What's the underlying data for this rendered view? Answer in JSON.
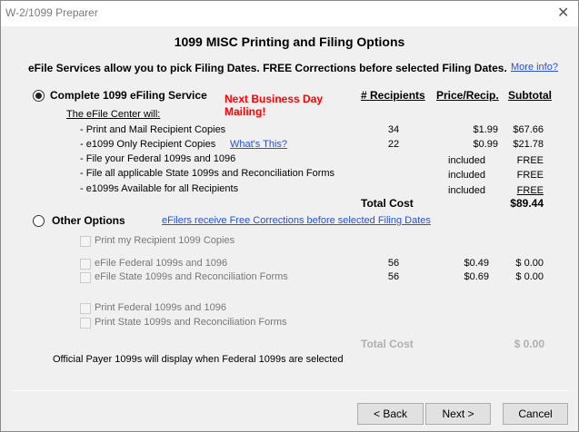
{
  "window": {
    "title": "W-2/1099 Preparer"
  },
  "heading": "1099 MISC Printing and Filing Options",
  "intro": "eFile Services allow you to pick Filing Dates. FREE Corrections before selected Filing Dates.",
  "more_info": "More info?",
  "complete": {
    "label": "Complete 1099 eFiling Service",
    "selected": true,
    "promo_line1": "Next Business Day",
    "promo_line2": "Mailing!",
    "headers": {
      "recipients": "# Recipients",
      "price": "Price/Recip.",
      "subtotal": "Subtotal"
    },
    "center_label": "The eFile Center will:",
    "whats_this": "What's This?",
    "rows": [
      {
        "label": "-  Print and Mail Recipient Copies",
        "recipients": "34",
        "price": "$1.99",
        "subtotal": "$67.66"
      },
      {
        "label": "-  e1099 Only Recipient Copies",
        "recipients": "22",
        "price": "$0.99",
        "subtotal": "$21.78"
      },
      {
        "label": "-  File your Federal 1099s and 1096",
        "recipients": "",
        "price": "included",
        "subtotal": "FREE"
      },
      {
        "label": "-  File all applicable State 1099s and Reconciliation Forms",
        "recipients": "",
        "price": "included",
        "subtotal": "FREE"
      },
      {
        "label": "- e1099s Available for all Recipients",
        "recipients": "",
        "price": "included",
        "subtotal": "FREE"
      }
    ],
    "total_label": "Total Cost",
    "total": "$89.44"
  },
  "other": {
    "label": "Other Options",
    "selected": false,
    "link": "eFilers receive Free Corrections before selected Filing Dates",
    "options": [
      {
        "label": "Print my Recipient 1099 Copies",
        "recipients": "",
        "price": "",
        "subtotal": ""
      },
      {
        "label": "eFile Federal 1099s and 1096",
        "recipients": "56",
        "price": "$0.49",
        "subtotal": "$ 0.00"
      },
      {
        "label": "eFile State 1099s and Reconciliation Forms",
        "recipients": "56",
        "price": "$0.69",
        "subtotal": "$ 0.00"
      },
      {
        "label": "Print Federal 1099s and 1096",
        "recipients": "",
        "price": "",
        "subtotal": ""
      },
      {
        "label": "Print State 1099s and Reconciliation Forms",
        "recipients": "",
        "price": "",
        "subtotal": ""
      }
    ],
    "total_label": "Total Cost",
    "total": "$ 0.00"
  },
  "note": "Official Payer 1099s will display when Federal 1099s are selected",
  "buttons": {
    "back": "< Back",
    "next": "Next >",
    "cancel": "Cancel"
  }
}
